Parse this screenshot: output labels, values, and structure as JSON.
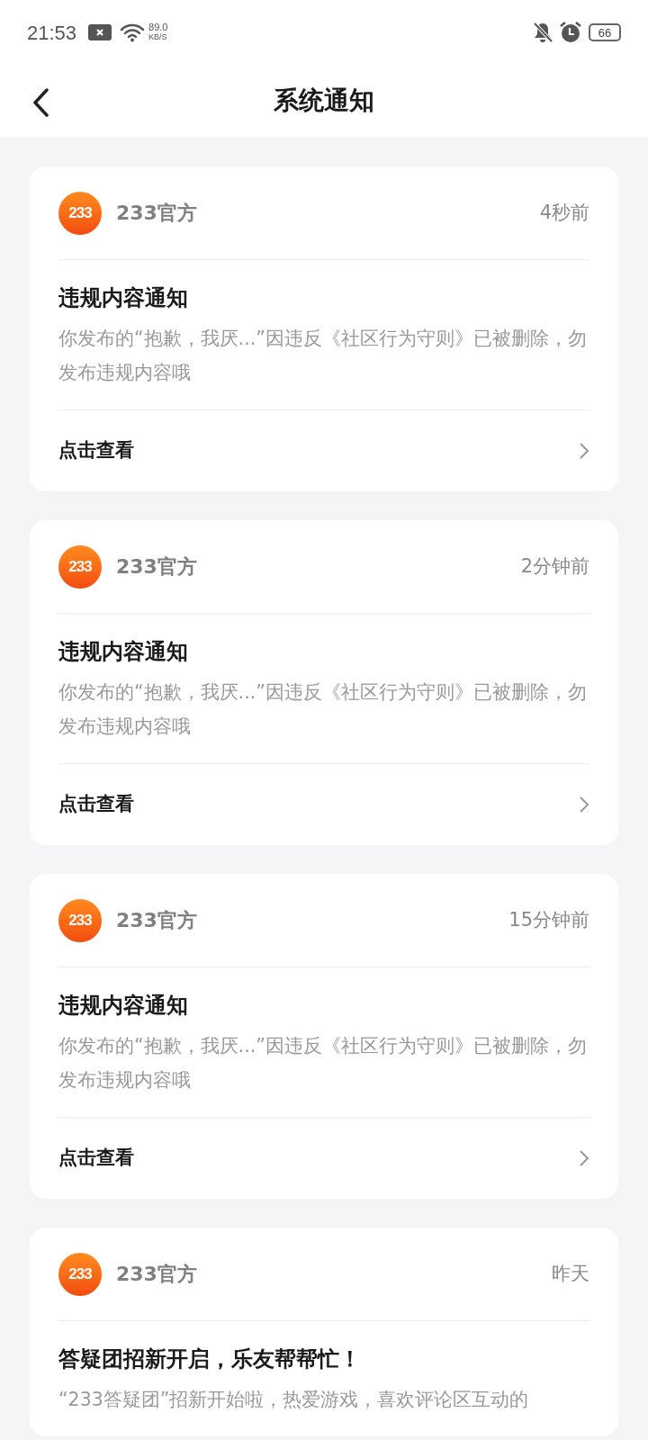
{
  "status_bar": {
    "time": "21:53",
    "net_speed": "89.0",
    "net_unit": "KB/S",
    "battery": "66"
  },
  "header": {
    "title": "系统通知"
  },
  "notifications": [
    {
      "logo_text": "233",
      "sender": "233官方",
      "time": "4秒前",
      "title": "违规内容通知",
      "body": "你发布的“抱歉，我厌...”因违反《社区行为守则》已被删除，勿发布违规内容哦",
      "action": "点击查看"
    },
    {
      "logo_text": "233",
      "sender": "233官方",
      "time": "2分钟前",
      "title": "违规内容通知",
      "body": "你发布的“抱歉，我厌...”因违反《社区行为守则》已被删除，勿发布违规内容哦",
      "action": "点击查看"
    },
    {
      "logo_text": "233",
      "sender": "233官方",
      "time": "15分钟前",
      "title": "违规内容通知",
      "body": "你发布的“抱歉，我厌...”因违反《社区行为守则》已被删除，勿发布违规内容哦",
      "action": "点击查看"
    },
    {
      "logo_text": "233",
      "sender": "233官方",
      "time": "昨天",
      "title": "答疑团招新开启，乐友帮帮忙！",
      "body": "“233答疑团”招新开始啦，热爱游戏，喜欢评论区互动的"
    }
  ]
}
